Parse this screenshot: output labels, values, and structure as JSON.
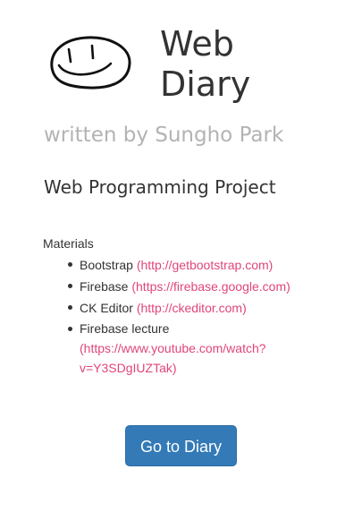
{
  "header": {
    "logo_icon": "smiley-face-icon",
    "title_line1": "Web",
    "title_line2": "Diary"
  },
  "byline": "written by Sungho Park",
  "project_title": "Web Programming Project",
  "materials": {
    "heading": "Materials",
    "items": [
      {
        "name": "Bootstrap",
        "link": "(http://getbootstrap.com)"
      },
      {
        "name": "Firebase",
        "link": "(https://firebase.google.com)"
      },
      {
        "name": "CK Editor",
        "link": "(http://ckeditor.com)"
      },
      {
        "name": "Firebase lecture",
        "link": "(https://www.youtube.com/watch?v=Y3SDgIUZTak)",
        "link_line1": "(https://www.youtube.com/watch?",
        "link_line2": "v=Y3SDgIUZTak)"
      }
    ]
  },
  "actions": {
    "go_button_label": "Go to Diary"
  },
  "colors": {
    "link": "#e0457b",
    "button_bg": "#337ab7",
    "byline": "#b3b3b3"
  }
}
